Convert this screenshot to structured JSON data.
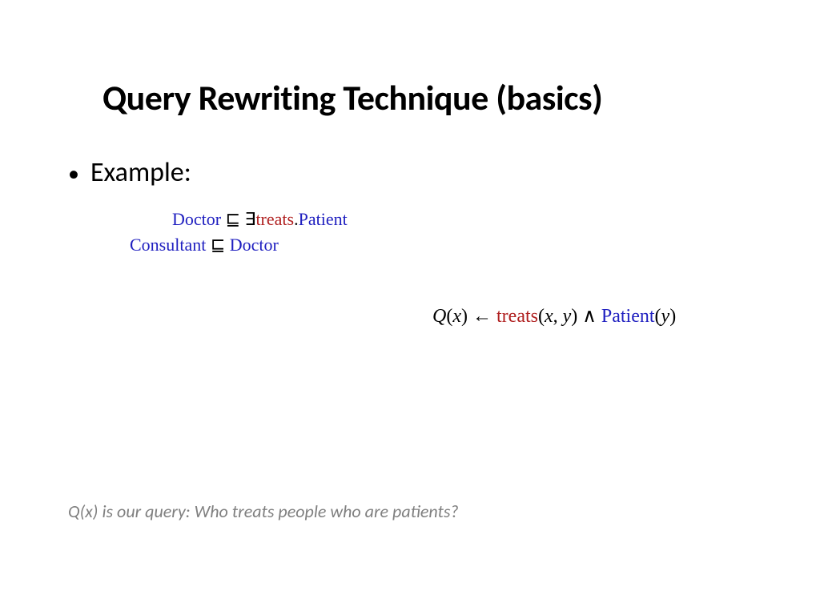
{
  "title": "Query Rewriting Technique (basics)",
  "bullet_label": "Example:",
  "axiom1": {
    "lhs": "Doctor",
    "sqsub": "⊑",
    "exists": "∃",
    "role": "treats",
    "dot": ".",
    "rhs": "Patient"
  },
  "axiom2": {
    "lhs": "Consultant",
    "sqsub": "⊑",
    "rhs": "Doctor"
  },
  "query": {
    "head": "Q",
    "open": "(",
    "x": "x",
    "close": ")",
    "arrow": " ← ",
    "role": "treats",
    "args_open": "(",
    "arg1": "x",
    "comma": ", ",
    "arg2": "y",
    "args_close": ")",
    "wedge": " ∧ ",
    "concept": "Patient",
    "cargs_open": "(",
    "carg": "y",
    "cargs_close": ")"
  },
  "footnote": "Q(x) is our query: Who treats people who are patients?"
}
